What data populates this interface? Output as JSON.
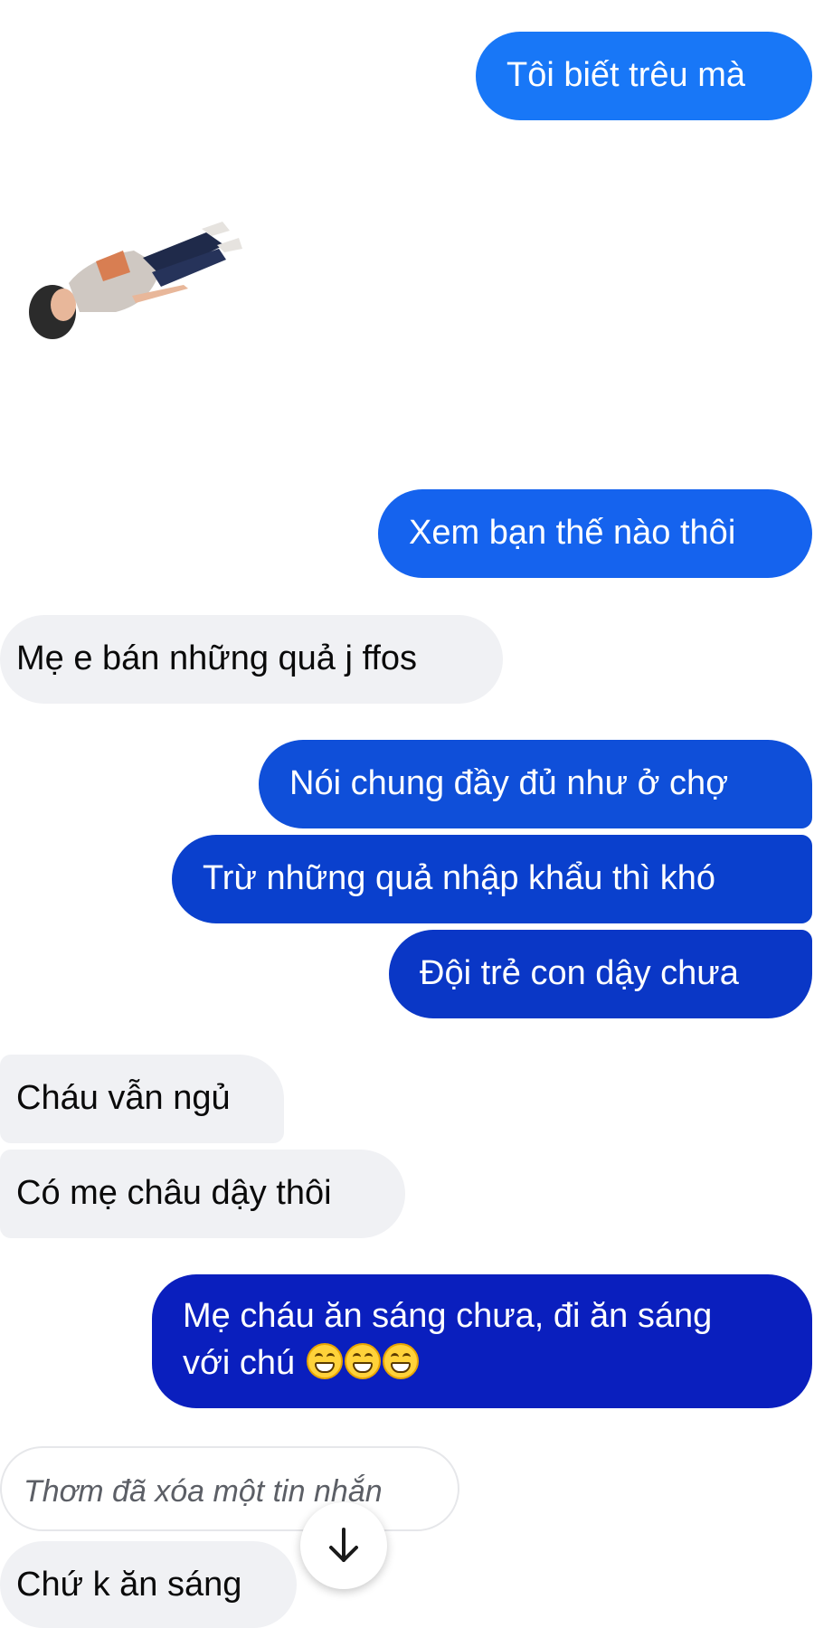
{
  "conversation": {
    "messages": [
      {
        "side": "outgoing",
        "text": "Tôi biết trêu mà"
      },
      {
        "side": "outgoing",
        "type": "sticker",
        "icon": "person-lying-face-down-sticker"
      },
      {
        "side": "outgoing",
        "text": "Xem bạn thế nào thôi"
      },
      {
        "side": "incoming",
        "text": "Mẹ e bán những quả j ffos"
      },
      {
        "side": "outgoing",
        "text": "Nói chung đầy đủ như ở chợ"
      },
      {
        "side": "outgoing",
        "text": "Trừ những quả nhập khẩu thì khó"
      },
      {
        "side": "outgoing",
        "text": "Đội trẻ con dậy chưa"
      },
      {
        "side": "incoming",
        "text": "Cháu vẫn ngủ"
      },
      {
        "side": "incoming",
        "text": "Có mẹ châu dậy thôi"
      },
      {
        "side": "outgoing",
        "text_line1": "Mẹ cháu ăn sáng chưa, đi ăn sáng",
        "text_line2": "với chú",
        "emoji": [
          "grinning-face-emoji",
          "grinning-face-emoji",
          "grinning-face-emoji"
        ]
      },
      {
        "side": "incoming",
        "type": "removed",
        "text": "Thơm đã xóa một tin nhắn"
      },
      {
        "side": "incoming",
        "text": "Chứ k ăn sáng"
      }
    ]
  },
  "controls": {
    "scroll_down_icon": "arrow-down-icon"
  },
  "colors": {
    "outgoing_top": "#1877f7",
    "outgoing_bottom": "#0a1fbe",
    "incoming_bg": "#f0f1f4"
  }
}
